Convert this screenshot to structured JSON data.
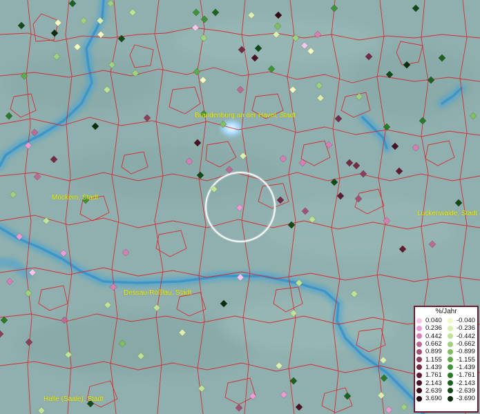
{
  "map": {
    "cities": [
      {
        "name": "Brandenburg an der Havel, Stadt"
      },
      {
        "name": "Möckern, Stadt"
      },
      {
        "name": "Luckenwalde, Stadt"
      },
      {
        "name": "Dessau-Roßlau, Stadt"
      },
      {
        "name": "Halle (Saale), Stadt"
      }
    ],
    "colors": {
      "background": "#8fb0ae",
      "river": "#3b95c8",
      "boundaries": "#d8262c",
      "label_text": "#f2f200",
      "selection_ring": "#ffffff",
      "legend_border": "#6a1a2a"
    }
  },
  "legend": {
    "title": "%/Jahr",
    "rows": [
      {
        "pos": "0.040",
        "pos_color": "#f6c6ea",
        "neg": "-0.040",
        "neg_color": "#f2f8c4"
      },
      {
        "pos": "0.236",
        "pos_color": "#ea9cd4",
        "neg": "-0.236",
        "neg_color": "#dcefb0"
      },
      {
        "pos": "0.442",
        "pos_color": "#d77fb5",
        "neg": "-0.442",
        "neg_color": "#bfe397"
      },
      {
        "pos": "0.662",
        "pos_color": "#bf6a96",
        "neg": "-0.662",
        "neg_color": "#9fd27f"
      },
      {
        "pos": "0.899",
        "pos_color": "#a55077",
        "neg": "-0.899",
        "neg_color": "#7fbf62"
      },
      {
        "pos": "1.155",
        "pos_color": "#8c3d5b",
        "neg": "-1.155",
        "neg_color": "#5faa4a"
      },
      {
        "pos": "1.439",
        "pos_color": "#742b45",
        "neg": "-1.439",
        "neg_color": "#3f9237"
      },
      {
        "pos": "1.761",
        "pos_color": "#5e1d33",
        "neg": "-1.761",
        "neg_color": "#2a7a2a"
      },
      {
        "pos": "2.143",
        "pos_color": "#4a1225",
        "neg": "-2.143",
        "neg_color": "#1c6220"
      },
      {
        "pos": "2.639",
        "pos_color": "#360a18",
        "neg": "-2.639",
        "neg_color": "#124a18"
      },
      {
        "pos": "3.690",
        "pos_color": "#22040d",
        "neg": "-3.690",
        "neg_color": "#0a2e0e"
      }
    ]
  }
}
